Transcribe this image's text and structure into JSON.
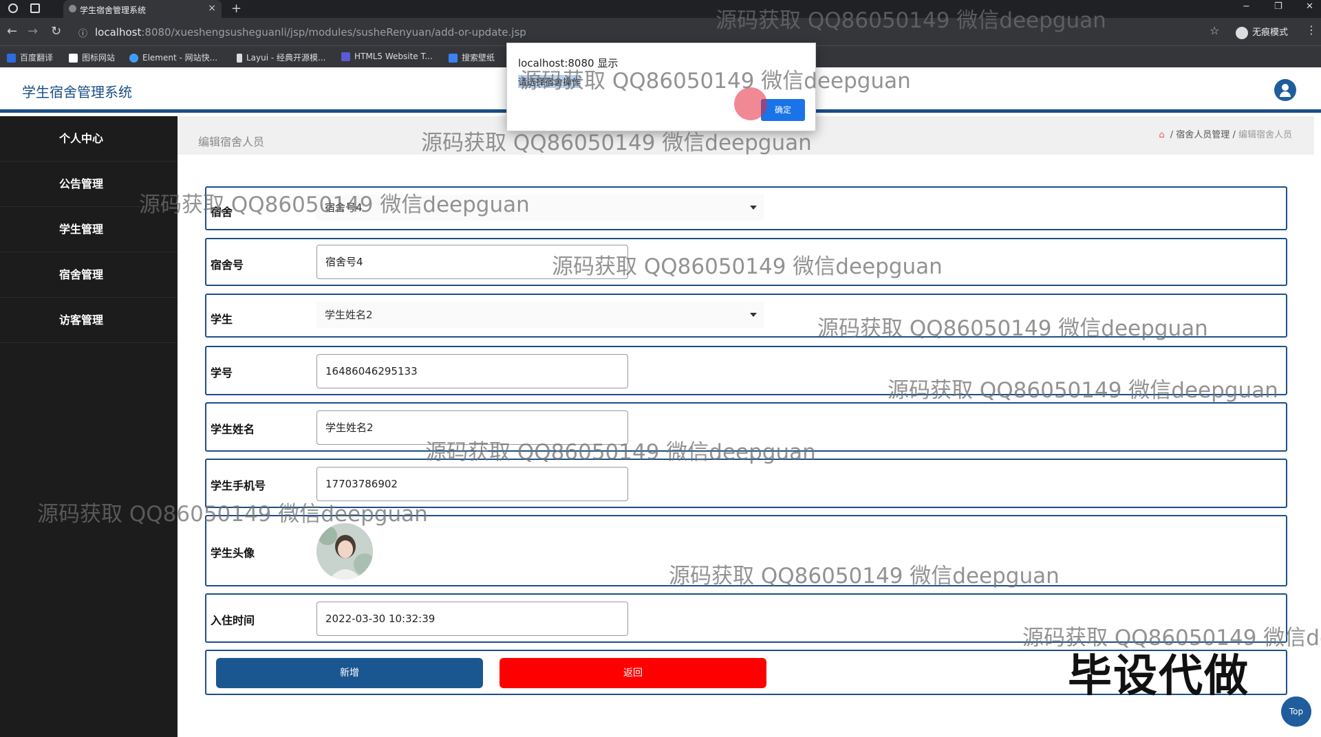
{
  "browser": {
    "tab_title": "学生宿舍管理系统",
    "tab_close": "×",
    "new_tab": "+",
    "window_controls": [
      "−",
      "❐",
      "✕"
    ],
    "url_host": "localhost",
    "url_path": ":8080/xueshengsusheguanli/jsp/modules/susheRenyuan/add-or-update.jsp",
    "incognito_label": "无痕模式",
    "bookmarks": [
      {
        "label": "百度翻译",
        "color": "#2d6cdf"
      },
      {
        "label": "图标网站",
        "color": "#ffffff"
      },
      {
        "label": "Element - 网站快...",
        "color": "#409eff"
      },
      {
        "label": "Layui - 经典开源模...",
        "color": "#dddddd"
      },
      {
        "label": "HTML5 Website T...",
        "color": "#5b5bd6"
      },
      {
        "label": "搜索壁纸",
        "color": "#3b82f6"
      }
    ]
  },
  "header": {
    "app_title": "学生宿舍管理系统"
  },
  "sidebar": {
    "items": [
      {
        "label": "个人中心"
      },
      {
        "label": "公告管理"
      },
      {
        "label": "学生管理"
      },
      {
        "label": "宿舍管理"
      },
      {
        "label": "访客管理"
      }
    ]
  },
  "page": {
    "title": "编辑宿舍人员",
    "breadcrumb": {
      "home_icon": "home-icon",
      "separator": "/",
      "level1": "宿舍人员管理",
      "current": "编辑宿舍人员"
    }
  },
  "form": {
    "sushe_label": "宿舍",
    "sushe_value": "宿舍号4",
    "sushe_hao_label": "宿舍号",
    "sushe_hao_value": "宿舍号4",
    "student_label": "学生",
    "student_value": "学生姓名2",
    "xuehao_label": "学号",
    "xuehao_value": "16486046295133",
    "name_label": "学生姓名",
    "name_value": "学生姓名2",
    "phone_label": "学生手机号",
    "phone_value": "17703786902",
    "photo_label": "学生头像",
    "checkin_label": "入住时间",
    "checkin_value": "2022-03-30 10:32:39",
    "add_button": "新增",
    "back_button": "返回"
  },
  "dialog": {
    "header": "localhost:8080 显示",
    "message": "请选择宿舍操作",
    "ok_button": "确定"
  },
  "top_button": "Top",
  "watermarks": {
    "text": "源码获取 QQ86050149 微信deepguan",
    "text_cut": "源码获取 QQ86050149 微信dee",
    "big": "毕设代做"
  },
  "colors": {
    "brand": "#1a4f86",
    "sidebar": "#1c1c1c",
    "add_button": "#1a5790",
    "back_button": "#ff0000"
  }
}
